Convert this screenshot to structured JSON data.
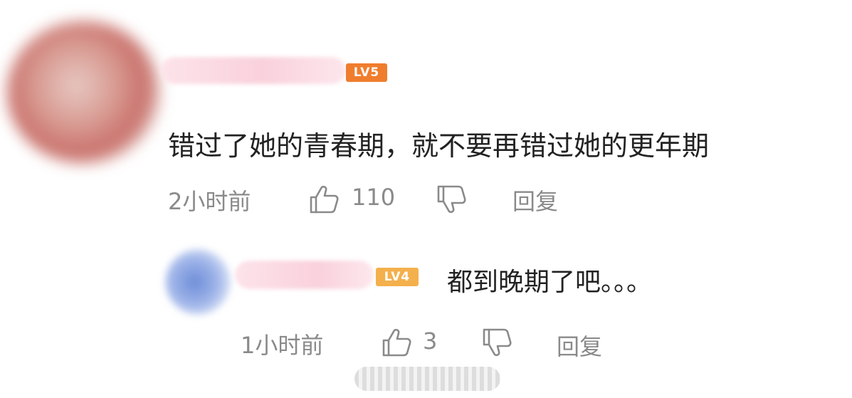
{
  "comment": {
    "level_badge": "LV5",
    "text": "错过了她的青春期，就不要再错过她的更年期",
    "time": "2小时前",
    "like_count": "110",
    "reply_label": "回复"
  },
  "reply": {
    "level_badge": "LV4",
    "text": "都到晚期了吧。。。",
    "time": "1小时前",
    "like_count": "3",
    "reply_label": "回复"
  },
  "icons": {
    "like": "thumbs-up-icon",
    "dislike": "thumbs-down-icon"
  },
  "colors": {
    "lv5_badge": "#f07d2d",
    "lv4_badge": "#f4b04c",
    "meta_text": "#8a8a8a",
    "body_text": "#222222"
  }
}
